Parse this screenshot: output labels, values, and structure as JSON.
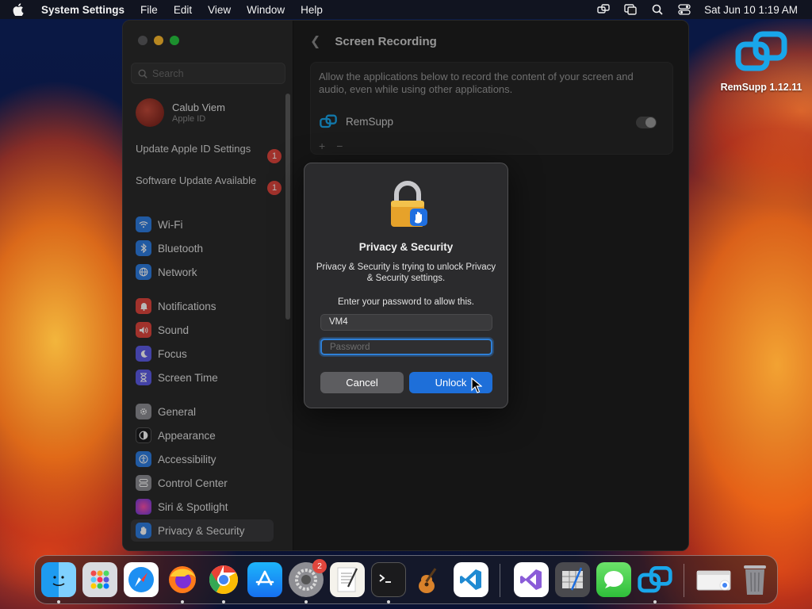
{
  "menubar": {
    "app_name": "System Settings",
    "items": [
      "File",
      "Edit",
      "View",
      "Window",
      "Help"
    ],
    "datetime": "Sat Jun 10  1:19 AM"
  },
  "desktop": {
    "icon_label": "RemSupp 1.12.11"
  },
  "sidebar": {
    "search_placeholder": "Search",
    "account": {
      "name": "Calub Viem",
      "sub": "Apple ID"
    },
    "notices": [
      {
        "label": "Update Apple ID Settings",
        "badge": "1"
      },
      {
        "label": "Software Update Available",
        "badge": "1"
      }
    ],
    "items": [
      {
        "label": "Wi-Fi",
        "icon": "wifi-icon",
        "color": "#2f7de1"
      },
      {
        "label": "Bluetooth",
        "icon": "bluetooth-icon",
        "color": "#2f7de1"
      },
      {
        "label": "Network",
        "icon": "globe-icon",
        "color": "#2f7de1"
      },
      {
        "label": "Notifications",
        "icon": "bell-icon",
        "color": "#e0463d"
      },
      {
        "label": "Sound",
        "icon": "speaker-icon",
        "color": "#e0463d"
      },
      {
        "label": "Focus",
        "icon": "moon-icon",
        "color": "#5e5ce6"
      },
      {
        "label": "Screen Time",
        "icon": "hourglass-icon",
        "color": "#5e5ce6"
      },
      {
        "label": "General",
        "icon": "gear-icon",
        "color": "#8e8e93"
      },
      {
        "label": "Appearance",
        "icon": "appearance-icon",
        "color": "#1c1c1e"
      },
      {
        "label": "Accessibility",
        "icon": "accessibility-icon",
        "color": "#2f7de1"
      },
      {
        "label": "Control Center",
        "icon": "control-center-icon",
        "color": "#8e8e93"
      },
      {
        "label": "Siri & Spotlight",
        "icon": "siri-icon",
        "color": "#b04ad8"
      },
      {
        "label": "Privacy & Security",
        "icon": "hand-icon",
        "color": "#2f7de1"
      }
    ]
  },
  "content": {
    "title": "Screen Recording",
    "description": "Allow the applications below to record the content of your screen and audio, even while using other applications.",
    "app_name": "RemSupp",
    "add_symbol": "+",
    "remove_symbol": "−"
  },
  "dialog": {
    "title": "Privacy & Security",
    "message": "Privacy & Security is trying to unlock Privacy & Security settings.",
    "prompt": "Enter your password to allow this.",
    "username_value": "VM4",
    "password_placeholder": "Password",
    "cancel_label": "Cancel",
    "unlock_label": "Unlock"
  },
  "dock": {
    "apps": [
      "Finder",
      "Launchpad",
      "Safari",
      "Firefox",
      "Chrome",
      "App Store",
      "System Settings",
      "TextEdit",
      "Terminal",
      "GarageBand",
      "Visual Studio Code",
      "Visual Studio",
      "Instruments",
      "Messages",
      "RemSupp",
      "Downloads",
      "Trash"
    ],
    "settings_badge": "2"
  },
  "colors": {
    "accent": "#1e6fd9",
    "badge": "#e0463d"
  }
}
